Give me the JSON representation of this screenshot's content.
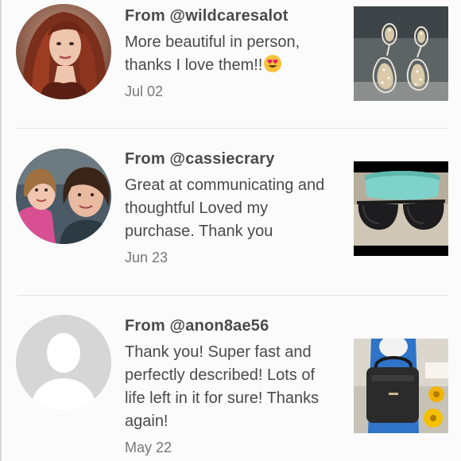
{
  "reviews": [
    {
      "from": "From @wildcaresalot",
      "text": "More beautiful in person, thanks I love them!!",
      "emoji": "heart-eyes-emoji",
      "date": "Jul 02",
      "avatar": "profile-photo-woman-red-hair",
      "thumbnail": "earrings-photo"
    },
    {
      "from": "From @cassiecrary",
      "text": "Great at communicating and thoughtful Loved my purchase. Thank you",
      "date": "Jun 23",
      "avatar": "profile-photo-mother-daughter",
      "thumbnail": "sunglasses-photo"
    },
    {
      "from": "From @anon8ae56",
      "text": "Thank you! Super fast and perfectly described! Lots of life left in it for sure! Thanks again!",
      "date": "May 22",
      "avatar": "default-avatar-silhouette",
      "thumbnail": "backpack-photo"
    }
  ],
  "colors": {
    "text": "#4a4a4a",
    "date": "#777777",
    "divider": "#e6e3e3",
    "background": "#fcfbfb"
  }
}
